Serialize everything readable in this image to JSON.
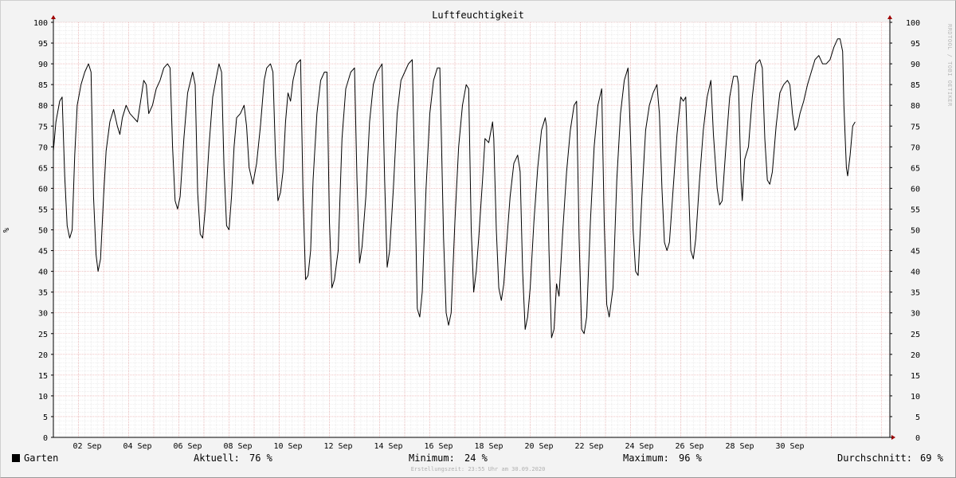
{
  "chart_data": {
    "type": "line",
    "title": "Luftfeuchtigkeit",
    "ylabel": "%",
    "ylim": [
      0,
      100
    ],
    "y_ticks": [
      "0",
      "5",
      "10",
      "15",
      "20",
      "25",
      "30",
      "35",
      "40",
      "45",
      "50",
      "55",
      "60",
      "65",
      "70",
      "75",
      "80",
      "85",
      "90",
      "95",
      "100"
    ],
    "x_ticks": [
      "02 Sep",
      "04 Sep",
      "06 Sep",
      "08 Sep",
      "10 Sep",
      "12 Sep",
      "14 Sep",
      "16 Sep",
      "18 Sep",
      "20 Sep",
      "22 Sep",
      "24 Sep",
      "26 Sep",
      "28 Sep",
      "30 Sep"
    ],
    "x_domain_days": [
      1,
      31
    ],
    "grid": true,
    "series": [
      {
        "name": "Garten",
        "color": "#000000",
        "points": [
          [
            1.0,
            69
          ],
          [
            1.1,
            76
          ],
          [
            1.25,
            81
          ],
          [
            1.35,
            82
          ],
          [
            1.45,
            63
          ],
          [
            1.55,
            51
          ],
          [
            1.65,
            48
          ],
          [
            1.75,
            50
          ],
          [
            1.85,
            68
          ],
          [
            1.95,
            80
          ],
          [
            2.1,
            85
          ],
          [
            2.25,
            88
          ],
          [
            2.4,
            90
          ],
          [
            2.5,
            88
          ],
          [
            2.6,
            58
          ],
          [
            2.7,
            44
          ],
          [
            2.78,
            40
          ],
          [
            2.88,
            43
          ],
          [
            3.0,
            58
          ],
          [
            3.1,
            69
          ],
          [
            3.25,
            76
          ],
          [
            3.4,
            79
          ],
          [
            3.55,
            75
          ],
          [
            3.65,
            73
          ],
          [
            3.75,
            77
          ],
          [
            3.9,
            80
          ],
          [
            4.05,
            78
          ],
          [
            4.2,
            77
          ],
          [
            4.35,
            76
          ],
          [
            4.5,
            82
          ],
          [
            4.6,
            86
          ],
          [
            4.7,
            85
          ],
          [
            4.8,
            78
          ],
          [
            4.95,
            80
          ],
          [
            5.1,
            84
          ],
          [
            5.25,
            86
          ],
          [
            5.4,
            89
          ],
          [
            5.55,
            90
          ],
          [
            5.65,
            89
          ],
          [
            5.75,
            70
          ],
          [
            5.85,
            57
          ],
          [
            5.95,
            55
          ],
          [
            6.05,
            58
          ],
          [
            6.2,
            72
          ],
          [
            6.35,
            83
          ],
          [
            6.55,
            88
          ],
          [
            6.65,
            85
          ],
          [
            6.75,
            59
          ],
          [
            6.85,
            49
          ],
          [
            6.95,
            48
          ],
          [
            7.05,
            55
          ],
          [
            7.2,
            70
          ],
          [
            7.35,
            82
          ],
          [
            7.5,
            87
          ],
          [
            7.6,
            90
          ],
          [
            7.7,
            88
          ],
          [
            7.8,
            65
          ],
          [
            7.9,
            51
          ],
          [
            8.0,
            50
          ],
          [
            8.1,
            58
          ],
          [
            8.2,
            70
          ],
          [
            8.3,
            77
          ],
          [
            8.45,
            78
          ],
          [
            8.6,
            80
          ],
          [
            8.7,
            75
          ],
          [
            8.8,
            65
          ],
          [
            8.95,
            61
          ],
          [
            9.1,
            66
          ],
          [
            9.25,
            75
          ],
          [
            9.4,
            86
          ],
          [
            9.5,
            89
          ],
          [
            9.65,
            90
          ],
          [
            9.75,
            88
          ],
          [
            9.85,
            68
          ],
          [
            9.95,
            57
          ],
          [
            10.05,
            59
          ],
          [
            10.15,
            64
          ],
          [
            10.25,
            76
          ],
          [
            10.35,
            83
          ],
          [
            10.45,
            81
          ],
          [
            10.55,
            86
          ],
          [
            10.7,
            90
          ],
          [
            10.85,
            91
          ],
          [
            10.95,
            58
          ],
          [
            11.05,
            38
          ],
          [
            11.15,
            39
          ],
          [
            11.25,
            45
          ],
          [
            11.35,
            62
          ],
          [
            11.5,
            78
          ],
          [
            11.65,
            86
          ],
          [
            11.8,
            88
          ],
          [
            11.9,
            88
          ],
          [
            12.0,
            52
          ],
          [
            12.1,
            36
          ],
          [
            12.2,
            38
          ],
          [
            12.35,
            45
          ],
          [
            12.5,
            72
          ],
          [
            12.65,
            84
          ],
          [
            12.85,
            88
          ],
          [
            13.0,
            89
          ],
          [
            13.1,
            62
          ],
          [
            13.2,
            42
          ],
          [
            13.3,
            46
          ],
          [
            13.45,
            58
          ],
          [
            13.6,
            76
          ],
          [
            13.75,
            85
          ],
          [
            13.9,
            88
          ],
          [
            14.1,
            90
          ],
          [
            14.2,
            62
          ],
          [
            14.3,
            41
          ],
          [
            14.4,
            45
          ],
          [
            14.55,
            60
          ],
          [
            14.7,
            78
          ],
          [
            14.85,
            86
          ],
          [
            15.0,
            88
          ],
          [
            15.15,
            90
          ],
          [
            15.3,
            91
          ],
          [
            15.4,
            62
          ],
          [
            15.5,
            31
          ],
          [
            15.6,
            29
          ],
          [
            15.7,
            35
          ],
          [
            15.85,
            60
          ],
          [
            16.0,
            78
          ],
          [
            16.15,
            86
          ],
          [
            16.3,
            89
          ],
          [
            16.4,
            89
          ],
          [
            16.55,
            48
          ],
          [
            16.65,
            30
          ],
          [
            16.75,
            27
          ],
          [
            16.85,
            30
          ],
          [
            17.0,
            52
          ],
          [
            17.15,
            70
          ],
          [
            17.3,
            80
          ],
          [
            17.45,
            85
          ],
          [
            17.55,
            84
          ],
          [
            17.65,
            50
          ],
          [
            17.75,
            35
          ],
          [
            17.85,
            40
          ],
          [
            17.95,
            48
          ],
          [
            18.1,
            62
          ],
          [
            18.2,
            72
          ],
          [
            18.35,
            71
          ],
          [
            18.5,
            76
          ],
          [
            18.55,
            72
          ],
          [
            18.65,
            50
          ],
          [
            18.75,
            36
          ],
          [
            18.85,
            33
          ],
          [
            18.95,
            37
          ],
          [
            19.1,
            50
          ],
          [
            19.2,
            58
          ],
          [
            19.35,
            66
          ],
          [
            19.5,
            68
          ],
          [
            19.6,
            64
          ],
          [
            19.7,
            40
          ],
          [
            19.8,
            26
          ],
          [
            19.9,
            29
          ],
          [
            20.0,
            36
          ],
          [
            20.15,
            52
          ],
          [
            20.3,
            65
          ],
          [
            20.45,
            74
          ],
          [
            20.6,
            77
          ],
          [
            20.65,
            75
          ],
          [
            20.75,
            45
          ],
          [
            20.85,
            24
          ],
          [
            20.95,
            26
          ],
          [
            21.05,
            37
          ],
          [
            21.15,
            34
          ],
          [
            21.3,
            50
          ],
          [
            21.45,
            64
          ],
          [
            21.6,
            74
          ],
          [
            21.75,
            80
          ],
          [
            21.85,
            81
          ],
          [
            21.95,
            48
          ],
          [
            22.05,
            26
          ],
          [
            22.15,
            25
          ],
          [
            22.25,
            29
          ],
          [
            22.4,
            52
          ],
          [
            22.55,
            70
          ],
          [
            22.7,
            80
          ],
          [
            22.85,
            84
          ],
          [
            22.95,
            52
          ],
          [
            23.05,
            32
          ],
          [
            23.15,
            29
          ],
          [
            23.3,
            36
          ],
          [
            23.45,
            62
          ],
          [
            23.6,
            78
          ],
          [
            23.75,
            86
          ],
          [
            23.9,
            89
          ],
          [
            24.0,
            72
          ],
          [
            24.1,
            50
          ],
          [
            24.2,
            40
          ],
          [
            24.3,
            39
          ],
          [
            24.45,
            58
          ],
          [
            24.6,
            74
          ],
          [
            24.75,
            80
          ],
          [
            24.9,
            83
          ],
          [
            25.05,
            85
          ],
          [
            25.15,
            78
          ],
          [
            25.25,
            60
          ],
          [
            25.35,
            47
          ],
          [
            25.45,
            45
          ],
          [
            25.55,
            47
          ],
          [
            25.7,
            60
          ],
          [
            25.85,
            73
          ],
          [
            26.0,
            82
          ],
          [
            26.1,
            81
          ],
          [
            26.2,
            82
          ],
          [
            26.3,
            62
          ],
          [
            26.4,
            45
          ],
          [
            26.5,
            43
          ],
          [
            26.6,
            48
          ],
          [
            26.75,
            62
          ],
          [
            26.9,
            74
          ],
          [
            27.05,
            82
          ],
          [
            27.2,
            86
          ],
          [
            27.3,
            73
          ],
          [
            27.45,
            60
          ],
          [
            27.55,
            56
          ],
          [
            27.65,
            57
          ],
          [
            27.8,
            70
          ],
          [
            27.95,
            82
          ],
          [
            28.1,
            87
          ],
          [
            28.25,
            87
          ],
          [
            28.3,
            85
          ],
          [
            28.4,
            62
          ],
          [
            28.45,
            57
          ],
          [
            28.55,
            67
          ],
          [
            28.7,
            70
          ],
          [
            28.85,
            82
          ],
          [
            29.0,
            90
          ],
          [
            29.15,
            91
          ],
          [
            29.25,
            89
          ],
          [
            29.35,
            72
          ],
          [
            29.45,
            62
          ],
          [
            29.55,
            61
          ],
          [
            29.65,
            64
          ],
          [
            29.8,
            75
          ],
          [
            29.95,
            83
          ],
          [
            30.1,
            85
          ],
          [
            30.25,
            86
          ],
          [
            30.35,
            85
          ],
          [
            30.45,
            78
          ],
          [
            30.55,
            74
          ],
          [
            30.65,
            75
          ],
          [
            30.75,
            78
          ],
          [
            30.9,
            81
          ],
          [
            31.05,
            85
          ],
          [
            31.2,
            88
          ],
          [
            31.35,
            91
          ],
          [
            31.5,
            92
          ],
          [
            31.65,
            90
          ],
          [
            31.8,
            90
          ],
          [
            31.95,
            91
          ],
          [
            32.1,
            94
          ],
          [
            32.25,
            96
          ],
          [
            32.35,
            96
          ],
          [
            32.45,
            93
          ],
          [
            32.5,
            80
          ],
          [
            32.6,
            65
          ],
          [
            32.65,
            63
          ],
          [
            32.75,
            68
          ],
          [
            32.85,
            75
          ],
          [
            32.95,
            76
          ]
        ]
      }
    ]
  },
  "legend": {
    "series_label": "Garten",
    "current_label": "Aktuell:",
    "current_value": "76 %",
    "min_label": "Minimum:",
    "min_value": "24 %",
    "max_label": "Maximum:",
    "max_value": "96 %",
    "avg_label": "Durchschnitt:",
    "avg_value": "69 %"
  },
  "footer": "Erstellungszeit: 23:55 Uhr am 30.09.2020",
  "watermark": "RRDTOOL / TOBI OETIKER",
  "colors": {
    "background": "#f3f3f3",
    "plot_background": "#ffffff",
    "grid_major": "#e8a0a0",
    "grid_minor": "#dcdcdc",
    "axis": "#000000",
    "arrow": "#a00000",
    "line": "#000000"
  }
}
